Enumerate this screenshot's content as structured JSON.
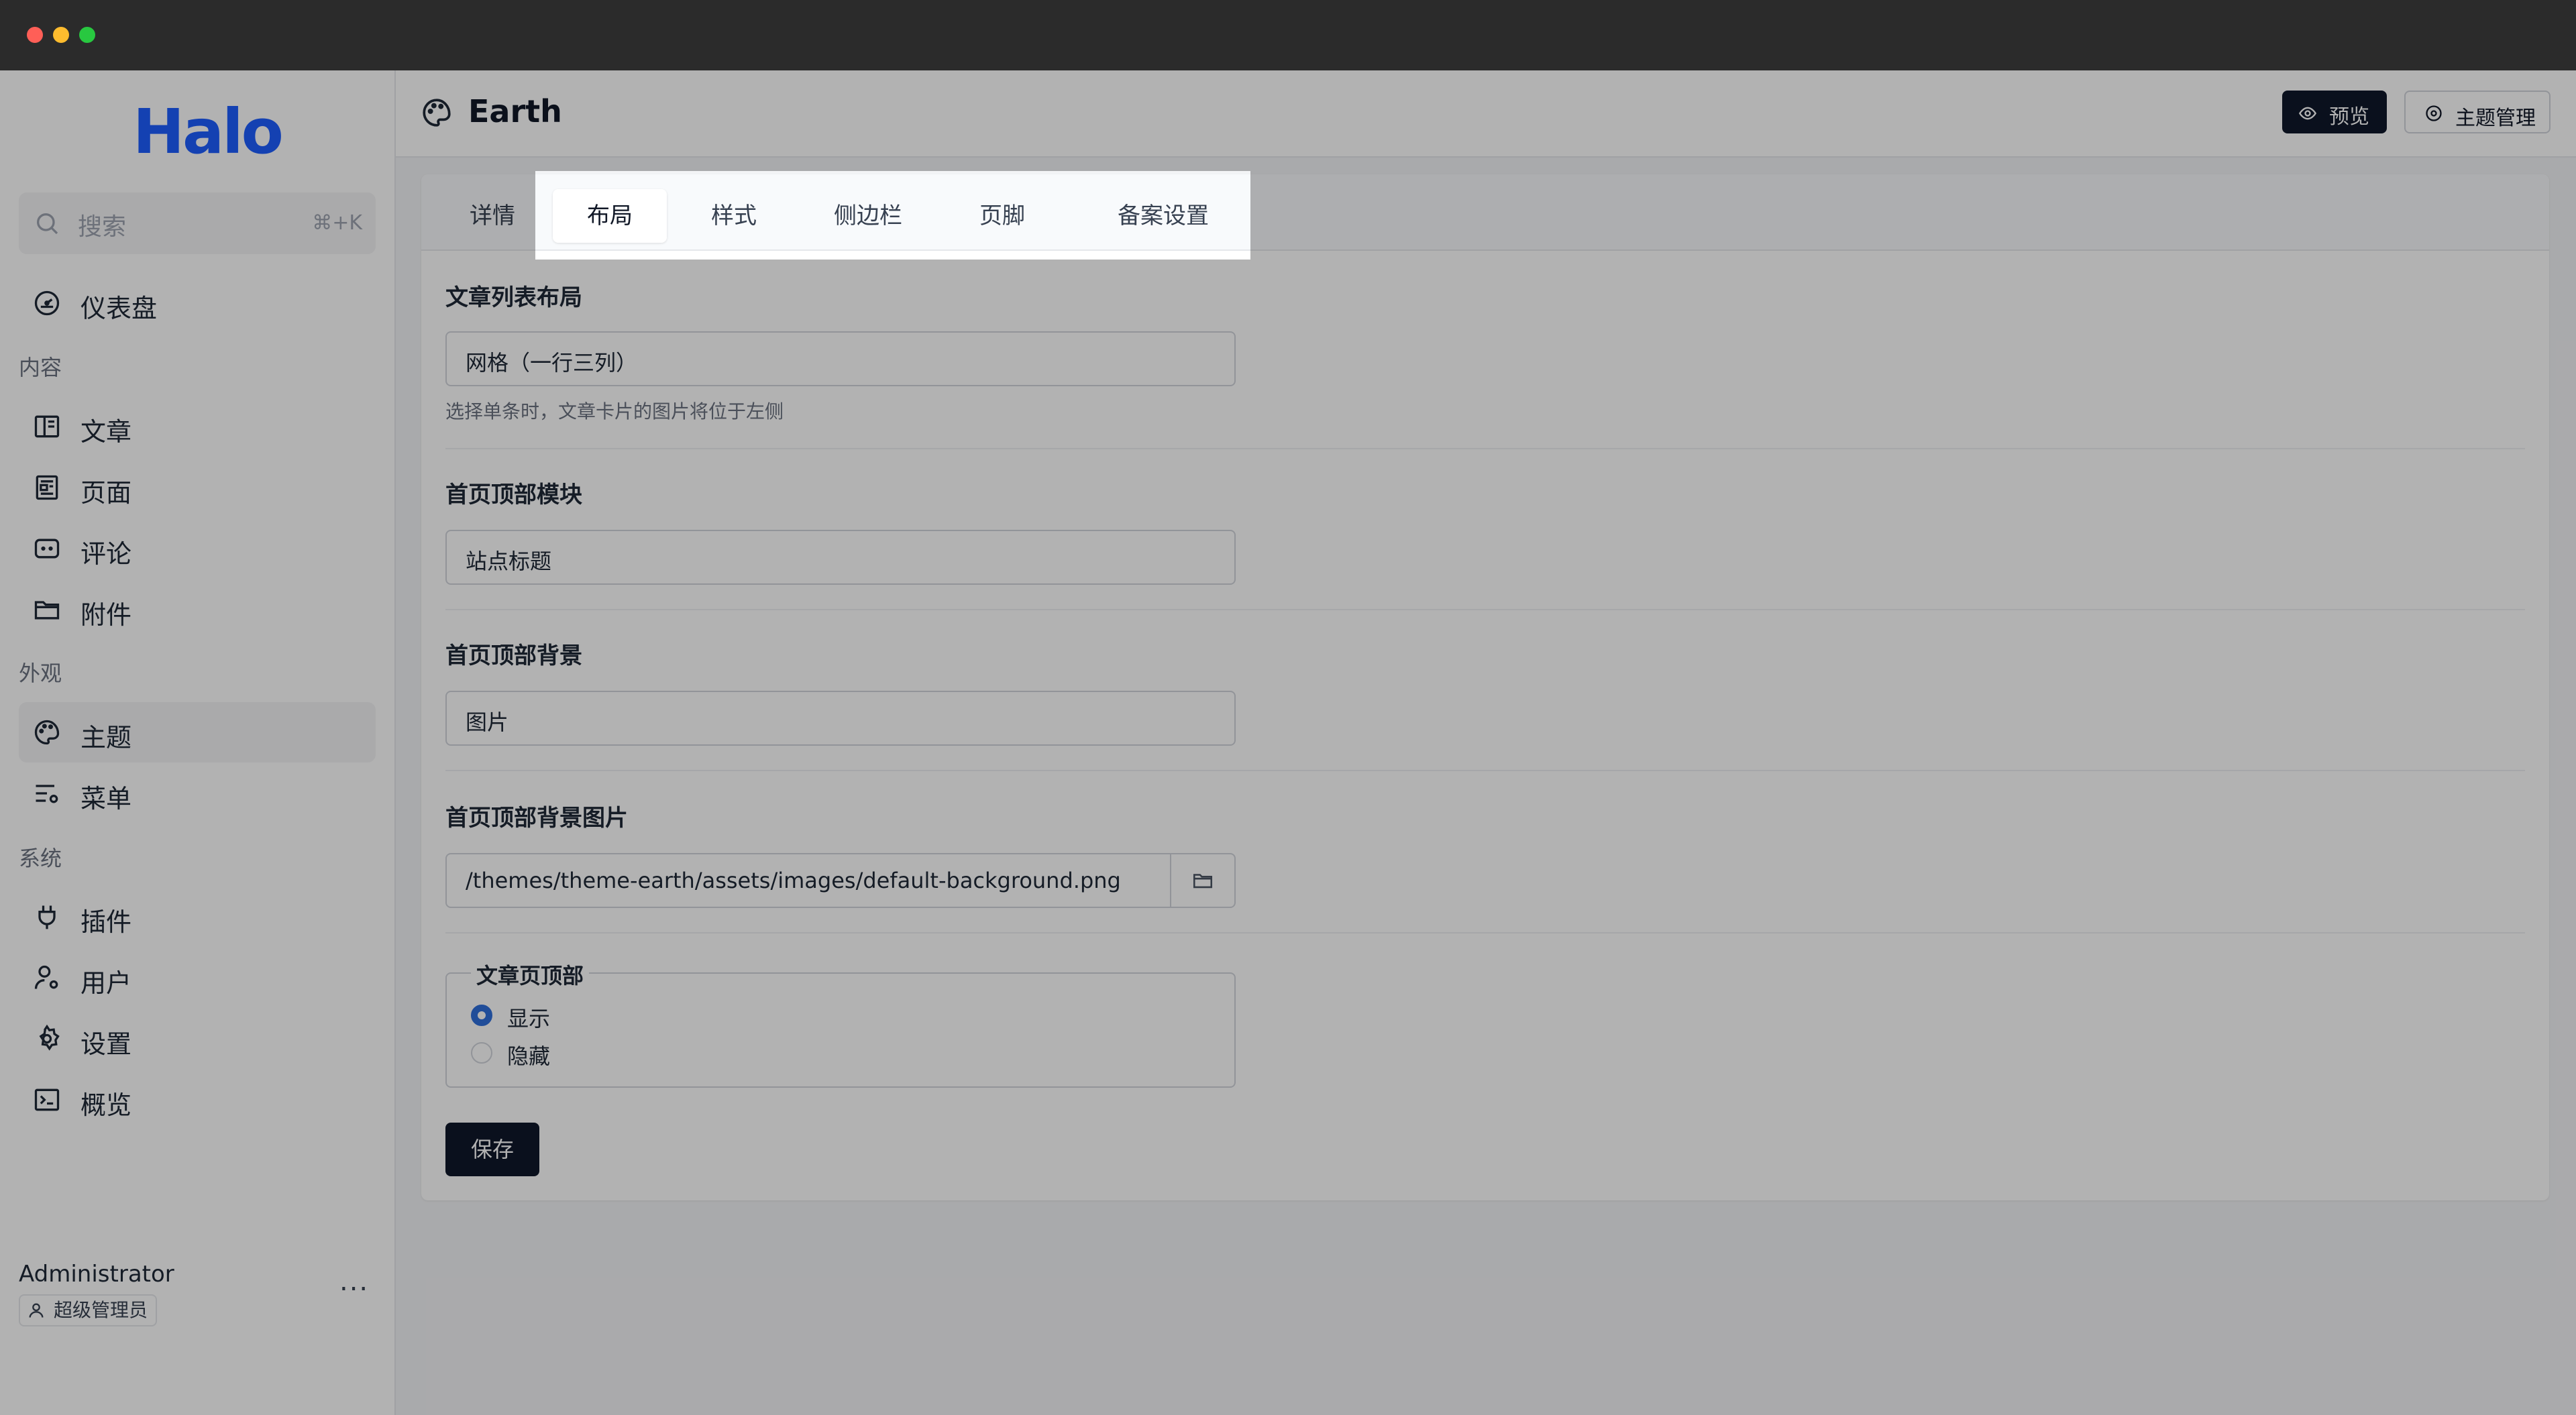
{
  "app": {
    "logo": "Halo"
  },
  "search": {
    "placeholder": "搜索",
    "shortcut": "⌘+K"
  },
  "sidebar": {
    "dashboard": "仪表盘",
    "groups": {
      "content": "内容",
      "appearance": "外观",
      "system": "系统"
    },
    "items": {
      "posts": "文章",
      "pages": "页面",
      "comments": "评论",
      "attachments": "附件",
      "themes": "主题",
      "menus": "菜单",
      "plugins": "插件",
      "users": "用户",
      "settings": "设置",
      "overview": "概览"
    },
    "active_item": "themes"
  },
  "user": {
    "name": "Administrator",
    "role": "超级管理员",
    "more": "..."
  },
  "header": {
    "title": "Earth",
    "preview_label": "预览",
    "theme_manage_label": "主题管理"
  },
  "tabs": [
    "详情",
    "布局",
    "样式",
    "侧边栏",
    "页脚",
    "备案设置"
  ],
  "active_tab": "布局",
  "form": {
    "post_list_layout": {
      "label": "文章列表布局",
      "value": "网格（一行三列）",
      "help": "选择单条时，文章卡片的图片将位于左侧"
    },
    "home_top_module": {
      "label": "首页顶部模块",
      "value": "站点标题"
    },
    "home_top_background": {
      "label": "首页顶部背景",
      "value": "图片"
    },
    "home_top_background_image": {
      "label": "首页顶部背景图片",
      "value": "/themes/theme-earth/assets/images/default-background.png"
    },
    "post_page_header": {
      "legend": "文章页顶部",
      "options": [
        "显示",
        "隐藏"
      ],
      "selected": "显示"
    },
    "save_label": "保存"
  },
  "colors": {
    "accent": "#1e5eff",
    "primary_button": "#0f172a",
    "radio_selected": "#2f6fdc",
    "overlay": "rgba(0,0,0,0.30)"
  }
}
